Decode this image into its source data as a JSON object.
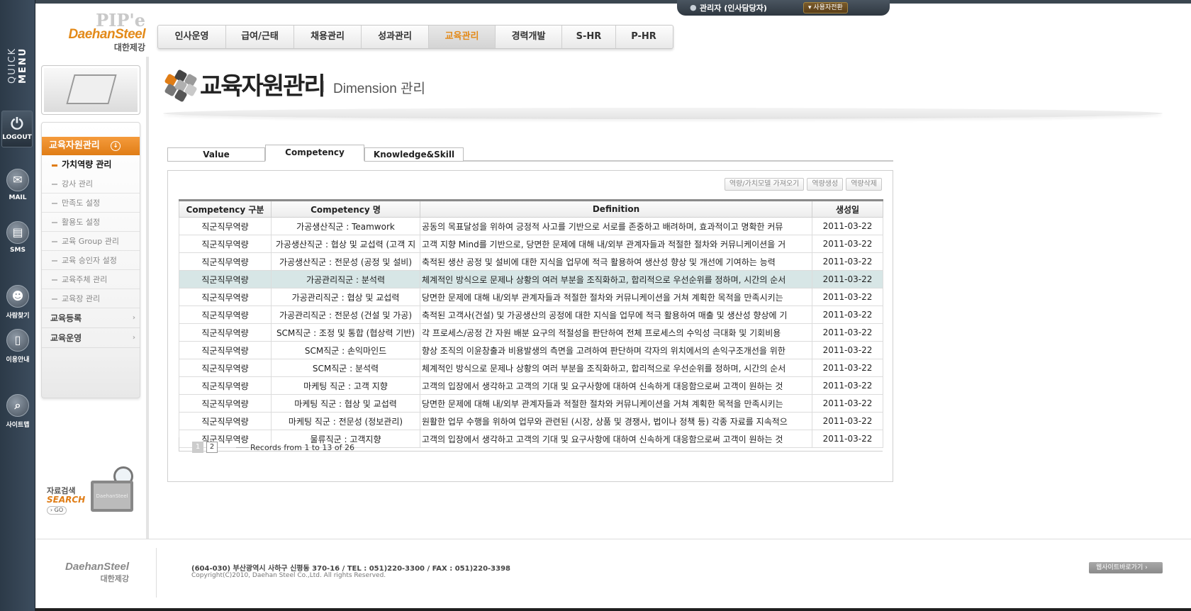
{
  "quick": {
    "label_thin": "QUICK ",
    "label_bold": "MENU",
    "logout": "LOGOUT",
    "items": [
      {
        "label": "MAIL",
        "icon": "mail-icon"
      },
      {
        "label": "SMS",
        "icon": "sms-icon"
      },
      {
        "label": "사람찾기",
        "icon": "people-icon"
      },
      {
        "label": "이용안내",
        "icon": "book-icon"
      },
      {
        "label": "사이트맵",
        "icon": "search-icon"
      }
    ]
  },
  "user": {
    "name": "관리자 (인사담당자)",
    "switch": "사용자전환"
  },
  "logo": {
    "pipe": "PIP'e",
    "brand": "DaehanSteel",
    "kr": "대한제강"
  },
  "gnb": [
    "인사운영",
    "급여/근태",
    "채용관리",
    "성과관리",
    "교육관리",
    "경력개발",
    "S-HR",
    "P-HR"
  ],
  "side": {
    "head": "교육자원관리",
    "subs": [
      "가치역량 관리",
      "강사 관리",
      "만족도 설정",
      "활용도 설정",
      "교육 Group 관리",
      "교육 승인자 설정",
      "교육주체 관리",
      "교육장 관리"
    ],
    "groups": [
      "교육등록",
      "교육운영"
    ]
  },
  "search": {
    "t1": "자료검색",
    "t2": "SEARCH",
    "go": "› GO",
    "screen": "DaehanSteel"
  },
  "page": {
    "title": "교육자원관리",
    "subtitle": "Dimension 관리"
  },
  "tabs": [
    "Value",
    "Competency",
    "Knowledge&Skill"
  ],
  "buttons": [
    "역량/가치모델 가져오기",
    "역량생성",
    "역량삭제"
  ],
  "table": {
    "headers": [
      "Competency 구분",
      "Competency 명",
      "Definition",
      "생성일"
    ],
    "rows": [
      [
        "직군직무역량",
        "가공생산직군 : Teamwork",
        "공동의 목표달성을 위하여 긍정적 사고를 기반으로 서로를 존중하고 배려하며, 효과적이고 명확한 커뮤",
        "2011-03-22"
      ],
      [
        "직군직무역량",
        "가공생산직군 : 협상 및 교섭력 (고객 지",
        "고객 지향 Mind를 기반으로, 당면한 문제에 대해 내/외부 관계자들과 적절한 절차와 커뮤니케이션을 거",
        "2011-03-22"
      ],
      [
        "직군직무역량",
        "가공생산직군 : 전문성 (공정 및 설비)",
        "축적된 생산 공정 및 설비에 대한 지식을 업무에 적극 활용하여 생산성 향상 및 개선에 기여하는 능력",
        "2011-03-22"
      ],
      [
        "직군직무역량",
        "가공관리직군 : 분석력",
        "체계적인 방식으로 문제나 상황의 여러 부분을 조직화하고, 합리적으로 우선순위를 정하며, 시간의 순서",
        "2011-03-22"
      ],
      [
        "직군직무역량",
        "가공관리직군 : 협상 및 교섭력",
        "당면한 문제에 대해 내/외부 관계자들과 적절한 절차와 커뮤니케이션을 거쳐 계획한 목적을 만족시키는",
        "2011-03-22"
      ],
      [
        "직군직무역량",
        "가공관리직군 : 전문성 (건설 및 가공)",
        "축적된 고객사(건설) 및 가공생산의 공정에 대한 지식을 업무에 적극 활용하여 매출 및 생산성 향상에 기",
        "2011-03-22"
      ],
      [
        "직군직무역량",
        "SCM직군 : 조정 및 통합 (협상력 기반)",
        "각 프로세스/공정 간 자원 배분 요구의 적절성을 판단하여 전체 프로세스의 수익성 극대화 및 기회비용",
        "2011-03-22"
      ],
      [
        "직군직무역량",
        "SCM직군 : 손익마인드",
        "향상 조직의 이윤창출과 비용발생의 측면을 고려하여 판단하며 각자의 위치에서의 손익구조개선을 위한",
        "2011-03-22"
      ],
      [
        "직군직무역량",
        "SCM직군 : 분석력",
        "체계적인 방식으로 문제나 상황의 여러 부분을 조직화하고, 합리적으로 우선순위를 정하며, 시간의 순서",
        "2011-03-22"
      ],
      [
        "직군직무역량",
        "마케팅 직군 : 고객 지향",
        "고객의 입장에서 생각하고 고객의 기대 및 요구사항에 대하여 신속하게 대응함으로써 고객이 원하는 것",
        "2011-03-22"
      ],
      [
        "직군직무역량",
        "마케팅 직군 : 협상 및 교섭력",
        "당면한 문제에 대해 내/외부 관계자들과 적절한 절차와 커뮤니케이션을 거쳐 계획한 목적을 만족시키는",
        "2011-03-22"
      ],
      [
        "직군직무역량",
        "마케팅 직군 : 전문성 (정보관리)",
        "원활한 업무 수행을 위하여 업무와 관련된 (시장, 상품 및 경쟁사, 법이나 정책 등) 각종 자료를 지속적으",
        "2011-03-22"
      ],
      [
        "직군직무역량",
        "물류직군 : 고객지향",
        "고객의 입장에서 생각하고 고객의 기대 및 요구사항에 대하여 신속하게 대응함으로써 고객이 원하는 것",
        "2011-03-22"
      ]
    ]
  },
  "pager": {
    "pages": [
      "1",
      "2"
    ],
    "records": "Records from 1 to 13 of 26"
  },
  "footer": {
    "brand": "DaehanSteel",
    "kr": "대한제강",
    "addr": "(604-030) 부산광역시 사하구 신평동 370-16   /   TEL : 051)220-3300   /   FAX : 051)220-3398",
    "copy": "Copyright(C)2010, Daehan Steel Co.,Ltd. All rights Reserved.",
    "site": "웹사이트바로가기  ›"
  },
  "colors": {
    "accent": "#e07d16",
    "highlight_row": "#d7e6e6"
  }
}
